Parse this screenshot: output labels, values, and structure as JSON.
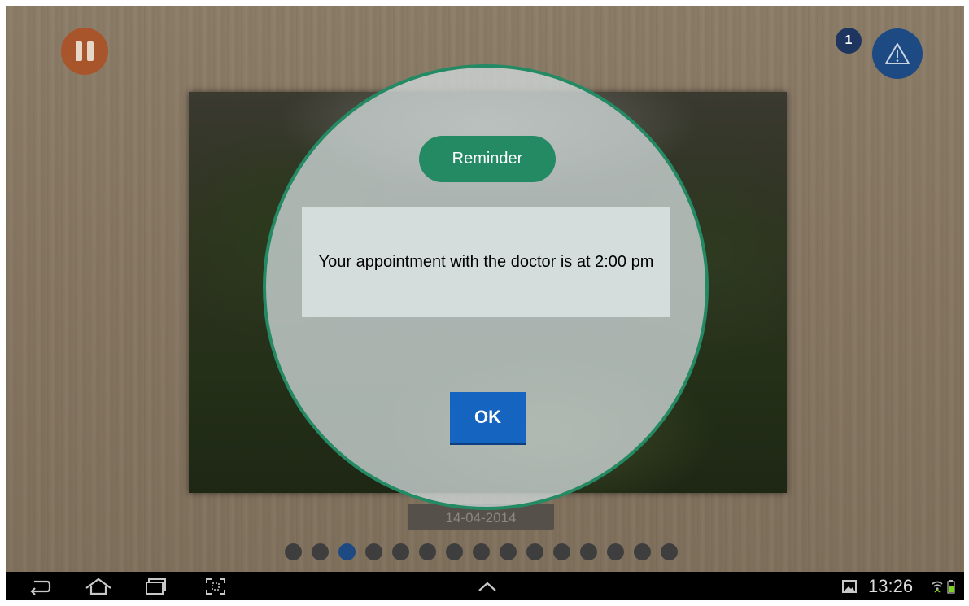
{
  "top_bar": {
    "pause_icon": "pause-icon",
    "notification_count": "1",
    "alert_icon": "warning-triangle-icon"
  },
  "slideshow": {
    "date": "14-04-2014",
    "dot_count": 15,
    "active_dot": 2
  },
  "dialog": {
    "title": "Reminder",
    "message": "Your appointment with the doctor is at 2:00 pm",
    "ok_label": "OK"
  },
  "system_bar": {
    "icons": [
      "back-icon",
      "home-icon",
      "recent-apps-icon",
      "screenshot-icon",
      "chevron-up-icon",
      "gallery-notification-icon",
      "wifi-icon",
      "battery-icon"
    ],
    "time": "13:26"
  },
  "colors": {
    "accent_green": "#248a64",
    "ok_blue": "#1565c0",
    "pause_orange": "#a8552b",
    "alert_blue": "#1d4a82"
  }
}
